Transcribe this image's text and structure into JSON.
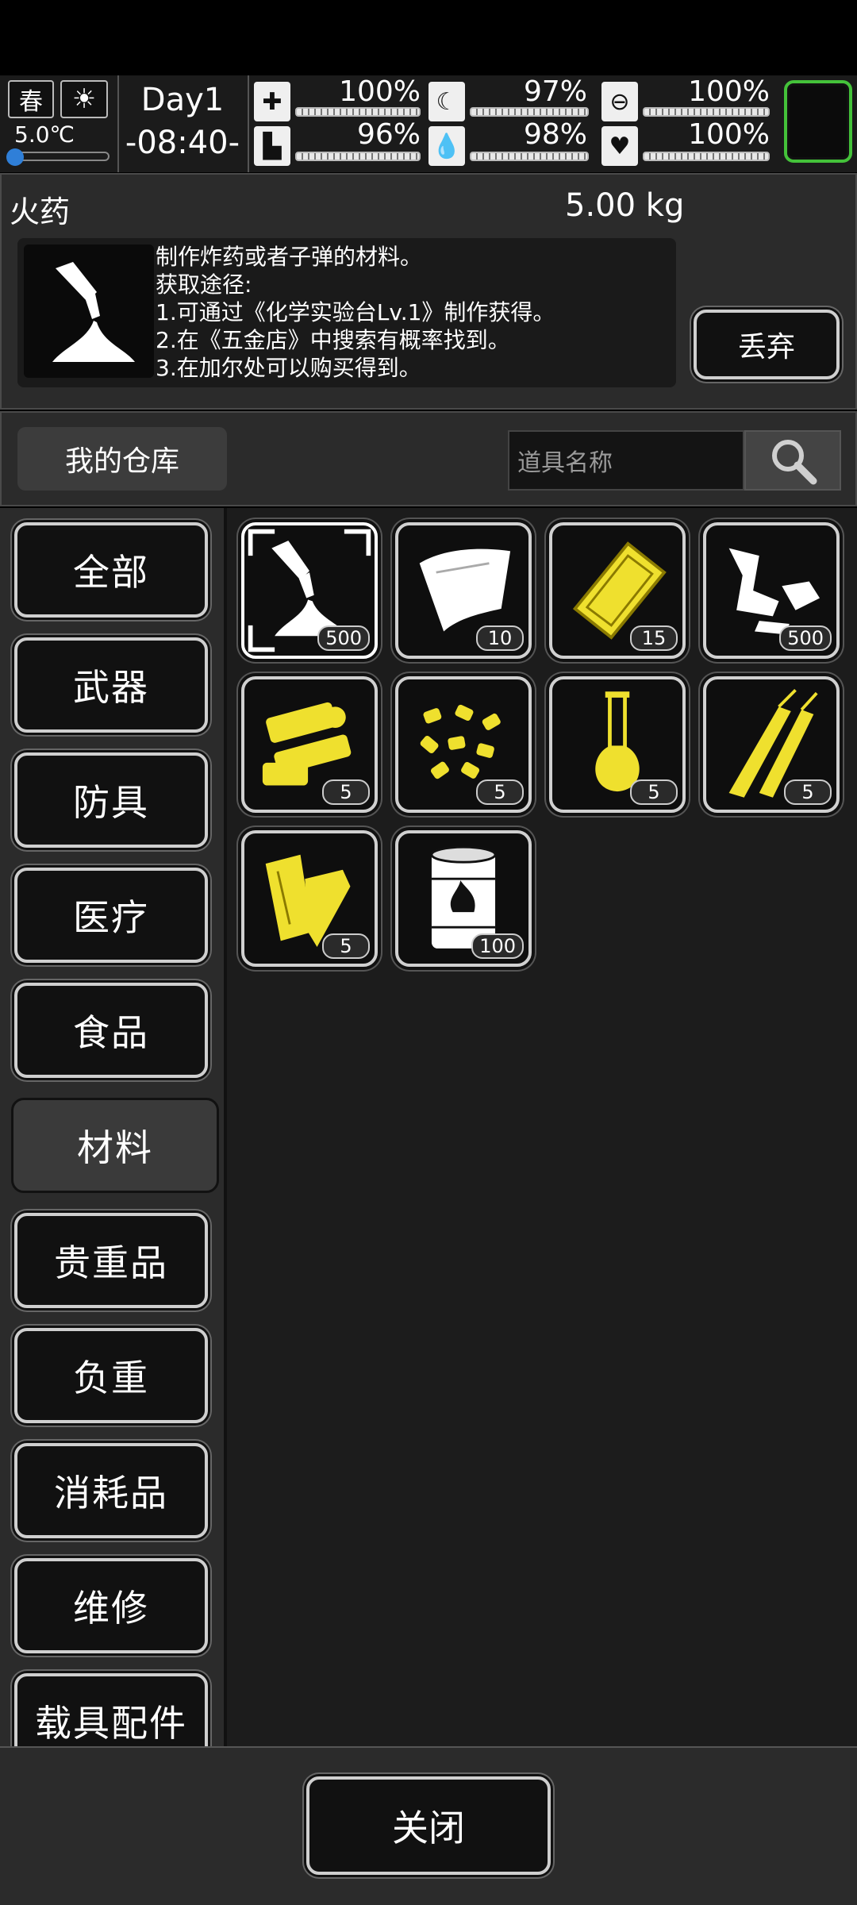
{
  "status": {
    "season": "春",
    "temperature": "5.0℃",
    "day": "Day1",
    "time": "-08:40-",
    "stats_top": [
      {
        "icon": "medkit-icon",
        "value": "100%",
        "level": 1.0
      },
      {
        "icon": "stomach-icon",
        "value": "97%",
        "level": 0.97
      },
      {
        "icon": "pill-icon",
        "value": "100%",
        "level": 1.0
      }
    ],
    "stats_bottom": [
      {
        "icon": "boot-icon",
        "value": "96%",
        "level": 0.96
      },
      {
        "icon": "water-drop-icon",
        "value": "98%",
        "level": 0.98
      },
      {
        "icon": "heart-icon",
        "value": "100%",
        "level": 1.0
      }
    ],
    "accent_green": "#44c23a"
  },
  "detail": {
    "name": "火药",
    "weight": "5.00 kg",
    "description": [
      "制作炸药或者子弹的材料。",
      "获取途径:",
      "1.可通过《化学实验台Lv.1》制作获得。",
      "2.在《五金店》中搜索有概率找到。",
      "3.在加尔处可以购买得到。"
    ],
    "discard_label": "丢弃"
  },
  "warehouse": {
    "title": "我的仓库",
    "search_placeholder": "道具名称"
  },
  "categories": [
    "全部",
    "武器",
    "防具",
    "医疗",
    "食品",
    "材料",
    "贵重品",
    "负重",
    "消耗品",
    "维修",
    "载具配件"
  ],
  "active_category": "材料",
  "items": [
    {
      "icon": "gunpowder-icon",
      "count": "500"
    },
    {
      "icon": "cloth-icon",
      "count": "10"
    },
    {
      "icon": "metal-plate-icon",
      "count": "15"
    },
    {
      "icon": "scrap-metal-icon",
      "count": "500"
    },
    {
      "icon": "machine-parts-icon",
      "count": "5"
    },
    {
      "icon": "pellets-icon",
      "count": "5"
    },
    {
      "icon": "flask-icon",
      "count": "5"
    },
    {
      "icon": "bamboo-icon",
      "count": "5"
    },
    {
      "icon": "wood-planks-icon",
      "count": "5"
    },
    {
      "icon": "fuel-barrel-icon",
      "count": "100"
    }
  ],
  "close_label": "关闭"
}
